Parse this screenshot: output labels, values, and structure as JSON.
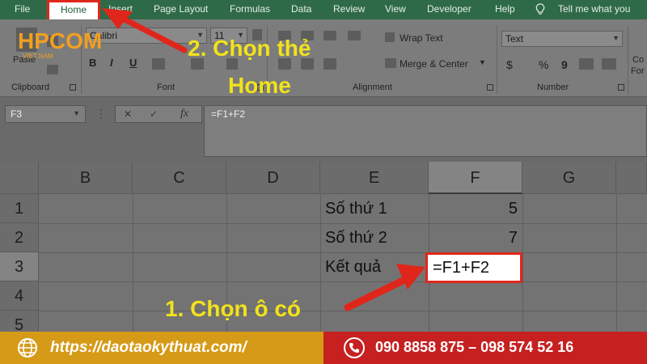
{
  "ribbon_tabs": {
    "file": "File",
    "home": "Home",
    "insert": "Insert",
    "page_layout": "Page Layout",
    "formulas": "Formulas",
    "data": "Data",
    "review": "Review",
    "view": "View",
    "developer": "Developer",
    "help": "Help",
    "tell_me": "Tell me what you want to do"
  },
  "ribbon": {
    "paste": "Paste",
    "clipboard": "Clipboard",
    "font_name": "Calibri",
    "font_size": "11",
    "bold": "B",
    "italic": "I",
    "underline": "U",
    "font_group": "Font",
    "wrap_text": "Wrap Text",
    "merge_center": "Merge & Center",
    "alignment_group": "Alignment",
    "number_format": "Text",
    "currency": "$",
    "percent": "%",
    "comma": "9",
    "number_group": "Number",
    "cond_format": "Co",
    "format_as": "For"
  },
  "logo": {
    "text": "HPCOM",
    "sub": "VIET NAM"
  },
  "formula_bar": {
    "name_box": "F3",
    "cancel": "✕",
    "enter": "✓",
    "fx": "fx",
    "formula": "=F1+F2"
  },
  "grid": {
    "columns": [
      "B",
      "C",
      "D",
      "E",
      "F",
      "G"
    ],
    "rows": [
      "1",
      "2",
      "3",
      "4",
      "5"
    ],
    "cells": {
      "e1": "Số thứ 1",
      "f1": "5",
      "e2": "Số thứ 2",
      "f2": "7",
      "e3": "Kết quả",
      "f3": "=F1+F2"
    }
  },
  "annotations": {
    "step2_line1": "2. Chọn thẻ",
    "step2_line2": "Home",
    "step1": "1. Chọn ô có"
  },
  "footer": {
    "website": "https://daotaokythuat.com/",
    "phones": "090 8858 875 – 098 574 52 16"
  },
  "colors": {
    "accent_red": "#e0261b",
    "annotation_yellow": "#f2e21c",
    "footer_orange": "#d59a17",
    "footer_red": "#c62020",
    "ribbon_green": "#2f6a48"
  }
}
